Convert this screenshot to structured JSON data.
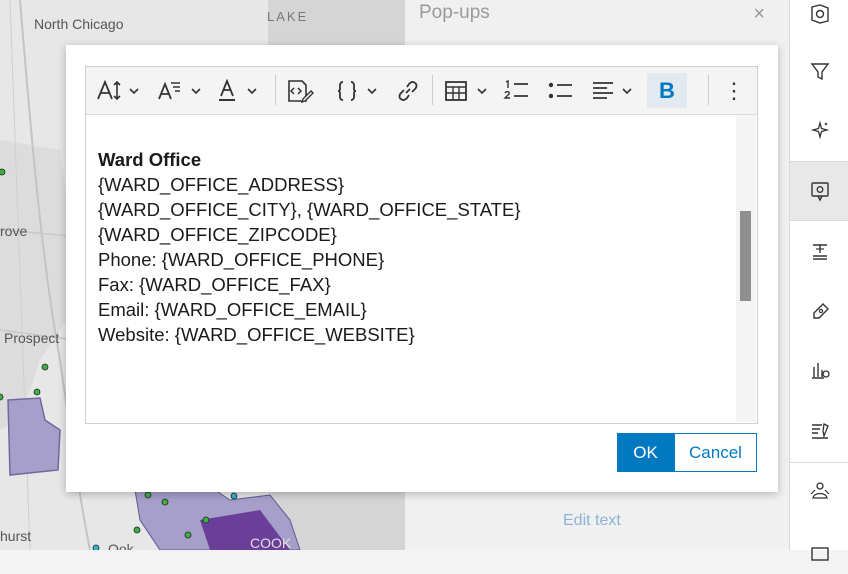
{
  "map": {
    "labels": {
      "north_chicago": "North Chicago",
      "lake": "LAKE",
      "grove": "rove",
      "prospect": "Prospect",
      "hurst": "hurst",
      "cook": "COOK",
      "ook": "Ook"
    }
  },
  "panel": {
    "title": "Pop-ups",
    "close_glyph": "×",
    "edit_text_label": "Edit text"
  },
  "modal": {
    "content": {
      "heading": "Ward Office",
      "lines": [
        "{WARD_OFFICE_ADDRESS}",
        "{WARD_OFFICE_CITY}, {WARD_OFFICE_STATE}",
        "{WARD_OFFICE_ZIPCODE}",
        "Phone: {WARD_OFFICE_PHONE}",
        "Fax: {WARD_OFFICE_FAX}",
        "Email: {WARD_OFFICE_EMAIL}",
        "Website: {WARD_OFFICE_WEBSITE}"
      ]
    },
    "ok_label": "OK",
    "cancel_label": "Cancel"
  },
  "toolbar": {
    "bold_label": "B",
    "more_glyph": "⋮",
    "expression_glyph": "{ }"
  },
  "rail": {
    "icons": [
      "basemap-icon",
      "filter-icon",
      "effects-icon",
      "popups-icon",
      "labels-icon",
      "styles-icon",
      "charts-icon",
      "forms-icon",
      "clustering-icon",
      "more-icon"
    ]
  },
  "colors": {
    "accent": "#0079c1",
    "link_faded": "#8bb3d8",
    "map_polygon": "#9a94c4",
    "map_point": "#3cb043"
  }
}
